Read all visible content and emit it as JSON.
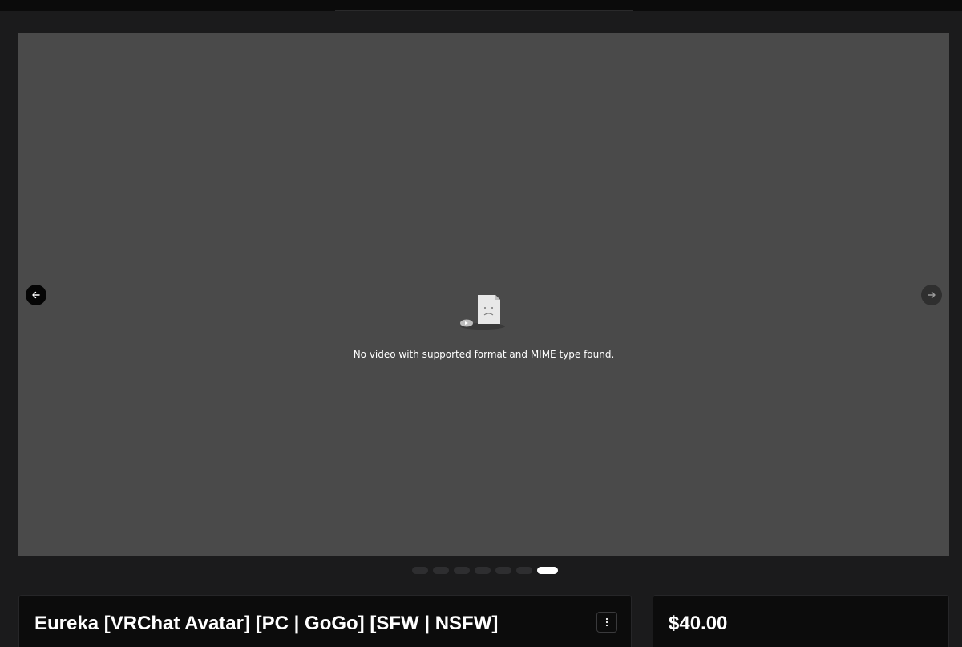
{
  "media": {
    "error_message": "No video with supported format and MIME type found.",
    "error_icon": "broken-video-icon",
    "prev_icon": "arrow-left-icon",
    "next_icon": "arrow-right-icon",
    "slide_count": 7,
    "active_slide": 7
  },
  "product": {
    "title": "Eureka [VRChat Avatar] [PC | GoGo] [SFW | NSFW]",
    "menu_icon": "more-vertical-icon",
    "price": "$40.00"
  },
  "colors": {
    "page_background": "#1b1b1c",
    "media_background": "#4a4a4a",
    "card_background": "#0c0c0c",
    "active_dot": "#ffffff",
    "inactive_dot": "#2e2e30"
  }
}
